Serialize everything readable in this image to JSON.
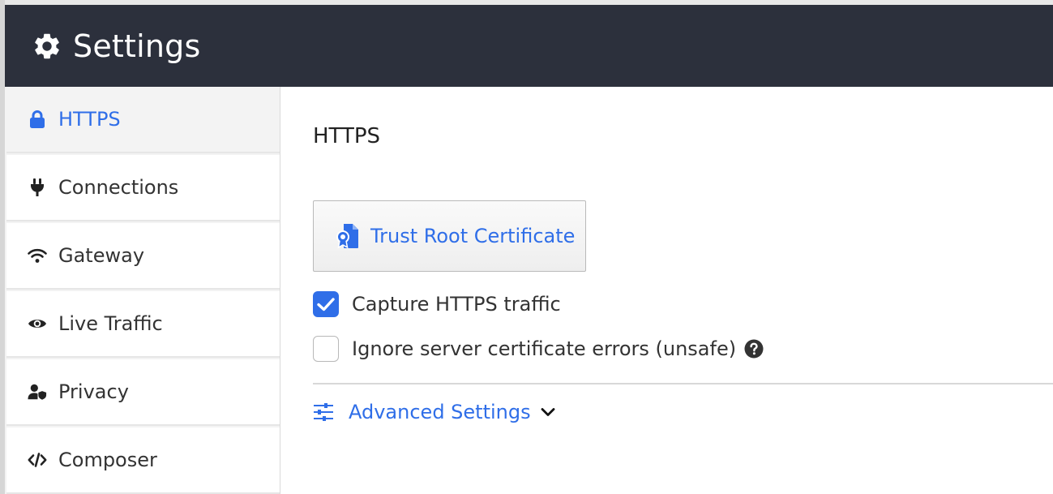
{
  "header": {
    "title": "Settings",
    "icon": "gear-icon"
  },
  "sidebar": {
    "items": [
      {
        "label": "HTTPS",
        "icon": "lock-icon",
        "active": true
      },
      {
        "label": "Connections",
        "icon": "plug-icon"
      },
      {
        "label": "Gateway",
        "icon": "wifi-icon"
      },
      {
        "label": "Live Traffic",
        "icon": "eye-icon"
      },
      {
        "label": "Privacy",
        "icon": "user-shield-icon"
      },
      {
        "label": "Composer",
        "icon": "code-icon"
      }
    ]
  },
  "main": {
    "title": "HTTPS",
    "trust_button": {
      "label": "Trust Root Certificate",
      "icon": "certificate-icon"
    },
    "options": [
      {
        "label": "Capture HTTPS traffic",
        "checked": true
      },
      {
        "label": "Ignore server certificate errors (unsafe)",
        "checked": false
      }
    ],
    "advanced": {
      "label": "Advanced Settings",
      "icon": "sliders-icon"
    }
  },
  "colors": {
    "header_bg": "#2c303c",
    "accent": "#2f6ee8",
    "sidebar_bg": "#f3f3f3"
  }
}
